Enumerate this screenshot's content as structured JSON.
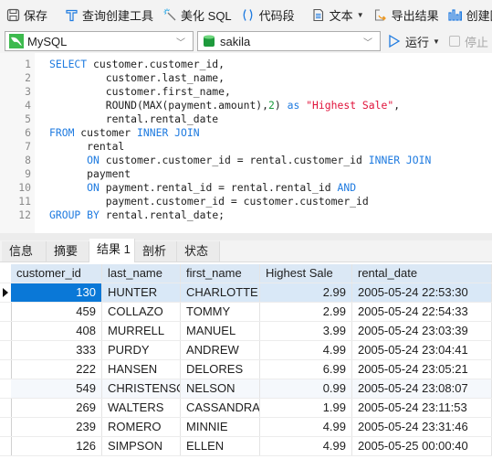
{
  "toolbar": {
    "save_label": "保存",
    "query_builder_label": "查询创建工具",
    "beautify_label": "美化 SQL",
    "snippet_label": "代码段",
    "text_label": "文本",
    "export_label": "导出结果",
    "create_chart_label": "创建图"
  },
  "connection": {
    "selected": "MySQL",
    "database": "sakila",
    "run_label": "运行",
    "stop_label": "停止"
  },
  "editor": {
    "lines": [
      {
        "n": "1"
      },
      {
        "n": "2"
      },
      {
        "n": "3"
      },
      {
        "n": "4"
      },
      {
        "n": "5"
      },
      {
        "n": "6"
      },
      {
        "n": "7"
      },
      {
        "n": "8"
      },
      {
        "n": "9"
      },
      {
        "n": "10"
      },
      {
        "n": "11"
      },
      {
        "n": "12"
      }
    ],
    "tokens": {
      "l1_kw": "SELECT",
      "l1_rest": " customer.customer_id,",
      "l2": "         customer.last_name,",
      "l3": "         customer.first_name,",
      "l4_a": "         ROUND(MAX(payment.amount),",
      "l4_num": "2",
      "l4_b": ") ",
      "l4_as": "as",
      "l4_sp": " ",
      "l4_str": "\"Highest Sale\"",
      "l4_c": ",",
      "l5": "         rental.rental_date",
      "l6_kw": "FROM",
      "l6_mid": " customer ",
      "l6_kw2": "INNER JOIN",
      "l7": "      rental",
      "l8_kw": "      ON",
      "l8_mid": " customer.customer_id = rental.customer_id ",
      "l8_kw2": "INNER JOIN",
      "l9": "      payment",
      "l10_kw": "      ON",
      "l10_mid": " payment.rental_id = rental.rental_id ",
      "l10_kw2": "AND",
      "l11": "         payment.customer_id = customer.customer_id",
      "l12_kw": "GROUP BY",
      "l12_rest": " rental.rental_date;"
    }
  },
  "result_tabs": [
    {
      "label": "信息"
    },
    {
      "label": "摘要"
    },
    {
      "label": "结果 1",
      "active": true
    },
    {
      "label": "剖析"
    },
    {
      "label": "状态"
    }
  ],
  "grid": {
    "columns": [
      "customer_id",
      "last_name",
      "first_name",
      "Highest Sale",
      "rental_date"
    ],
    "rows": [
      [
        "130",
        "HUNTER",
        "CHARLOTTE",
        "2.99",
        "2005-05-24 22:53:30"
      ],
      [
        "459",
        "COLLAZO",
        "TOMMY",
        "2.99",
        "2005-05-24 22:54:33"
      ],
      [
        "408",
        "MURRELL",
        "MANUEL",
        "3.99",
        "2005-05-24 23:03:39"
      ],
      [
        "333",
        "PURDY",
        "ANDREW",
        "4.99",
        "2005-05-24 23:04:41"
      ],
      [
        "222",
        "HANSEN",
        "DELORES",
        "6.99",
        "2005-05-24 23:05:21"
      ],
      [
        "549",
        "CHRISTENSON",
        "NELSON",
        "0.99",
        "2005-05-24 23:08:07"
      ],
      [
        "269",
        "WALTERS",
        "CASSANDRA",
        "1.99",
        "2005-05-24 23:11:53"
      ],
      [
        "239",
        "ROMERO",
        "MINNIE",
        "4.99",
        "2005-05-24 23:31:46"
      ],
      [
        "126",
        "SIMPSON",
        "ELLEN",
        "4.99",
        "2005-05-25 00:00:40"
      ]
    ],
    "selected_row": 0
  },
  "colors": {
    "accent": "#0a78d7",
    "keyword": "#1f7be0",
    "string": "#e0123a",
    "number": "#1a9b3c"
  }
}
